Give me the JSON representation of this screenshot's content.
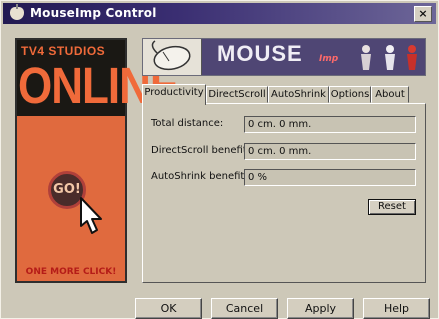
{
  "window": {
    "title": "MouseImp Control",
    "close_glyph": "×"
  },
  "ad": {
    "studios": "TV4 STUDIOS",
    "online": "ONLINE",
    "go": "GO!",
    "tagline": "ONE MORE CLICK!",
    "colors": {
      "panel": "#e06a3e",
      "dark": "#1a1814",
      "text": "#f06a3a"
    }
  },
  "banner": {
    "title": "MOUSE",
    "subtitle": "Imp",
    "icons": [
      "mouse-device-icon",
      "figure-red-icon",
      "figure-white-icon",
      "figure-red-icon"
    ]
  },
  "tabs": [
    {
      "label": "Productivity",
      "active": true
    },
    {
      "label": "DirectScroll",
      "active": false
    },
    {
      "label": "AutoShrink",
      "active": false
    },
    {
      "label": "Options",
      "active": false
    },
    {
      "label": "About",
      "active": false
    }
  ],
  "fields": [
    {
      "label": "Total distance:",
      "value": "0 cm. 0 mm."
    },
    {
      "label": "DirectScroll benefit:",
      "value": "0 cm. 0 mm."
    },
    {
      "label": "AutoShrink benefit:",
      "value": "0 %"
    }
  ],
  "reset_label": "Reset",
  "buttons": {
    "ok": "OK",
    "cancel": "Cancel",
    "apply": "Apply",
    "help": "Help"
  }
}
